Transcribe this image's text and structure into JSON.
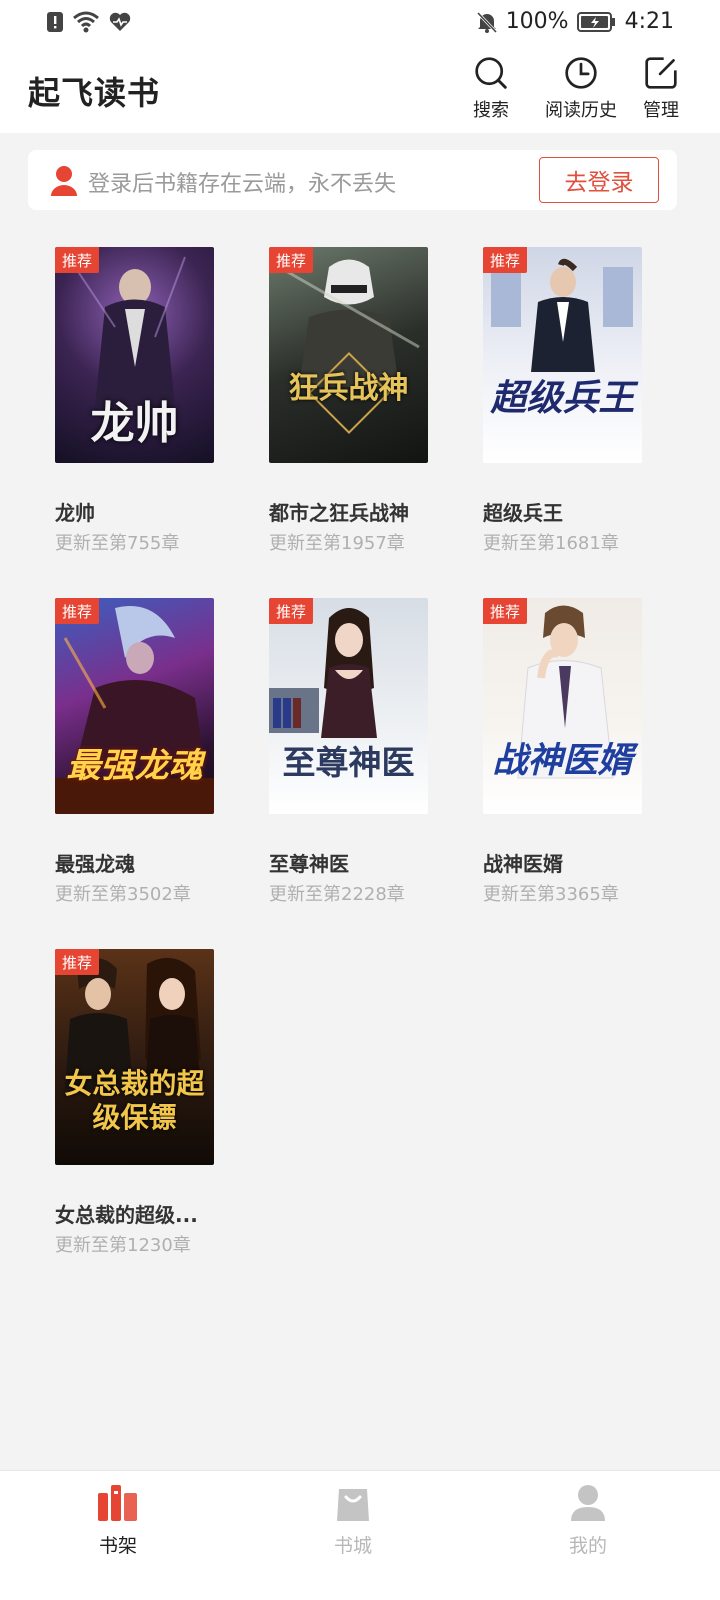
{
  "status_bar": {
    "battery": "100%",
    "time": "4:21",
    "icons": [
      "alert-icon",
      "wifi-icon",
      "heart-icon",
      "bell-off-icon",
      "battery-icon"
    ]
  },
  "header": {
    "title": "起飞读书",
    "actions": [
      {
        "label": "搜索",
        "icon": "search-icon"
      },
      {
        "label": "阅读历史",
        "icon": "history-icon"
      },
      {
        "label": "管理",
        "icon": "edit-icon"
      }
    ]
  },
  "login_banner": {
    "message": "登录后书籍存在云端，永不丢失",
    "button": "去登录"
  },
  "books": [
    {
      "title": "龙帅",
      "update": "更新至第755章",
      "tag": "推荐",
      "cover_text": "龙帅"
    },
    {
      "title": "都市之狂兵战神",
      "update": "更新至第1957章",
      "tag": "推荐",
      "cover_text": "狂兵战神"
    },
    {
      "title": "超级兵王",
      "update": "更新至第1681章",
      "tag": "推荐",
      "cover_text": "超级兵王"
    },
    {
      "title": "最强龙魂",
      "update": "更新至第3502章",
      "tag": "推荐",
      "cover_text": "最强龙魂"
    },
    {
      "title": "至尊神医",
      "update": "更新至第2228章",
      "tag": "推荐",
      "cover_text": "至尊神医"
    },
    {
      "title": "战神医婿",
      "update": "更新至第3365章",
      "tag": "推荐",
      "cover_text": "战神医婿"
    },
    {
      "title": "女总裁的超级...",
      "update": "更新至第1230章",
      "tag": "推荐",
      "cover_text": "女总裁的超级保镖"
    }
  ],
  "bottom_nav": [
    {
      "label": "书架",
      "icon": "bookshelf-icon",
      "active": true
    },
    {
      "label": "书城",
      "icon": "bookstore-icon",
      "active": false
    },
    {
      "label": "我的",
      "icon": "profile-icon",
      "active": false
    }
  ],
  "colors": {
    "accent": "#e54532",
    "inactive": "#b8b8b8",
    "background": "#f3f3f3"
  }
}
